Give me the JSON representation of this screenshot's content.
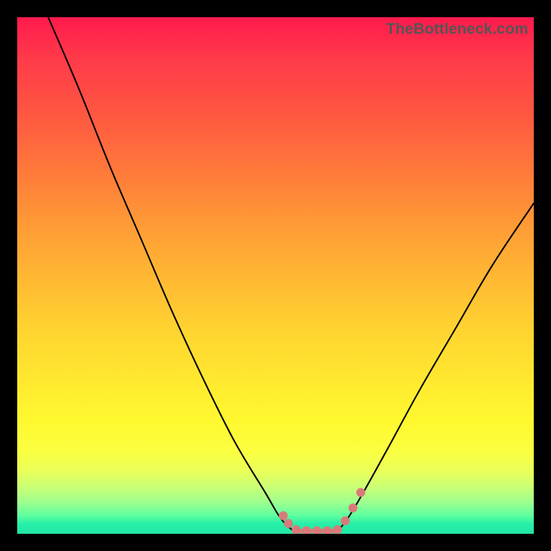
{
  "watermark": "TheBottleneck.com",
  "colors": {
    "frame": "#000000",
    "gradient_top": "#ff1a4d",
    "gradient_bottom": "#20e8a5",
    "curve": "#000000",
    "marker": "#d97a7a"
  },
  "chart_data": {
    "type": "line",
    "title": "",
    "xlabel": "",
    "ylabel": "",
    "xlim": [
      0,
      100
    ],
    "ylim": [
      0,
      100
    ],
    "series": [
      {
        "name": "left-curve",
        "x": [
          6,
          12,
          18,
          24,
          30,
          36,
          42,
          48,
          51,
          53.5
        ],
        "y": [
          100,
          86,
          71,
          57,
          43,
          30,
          18,
          8,
          3,
          0.5
        ]
      },
      {
        "name": "right-curve",
        "x": [
          62,
          64,
          67,
          72,
          78,
          85,
          92,
          100
        ],
        "y": [
          0.5,
          3,
          8,
          17,
          28,
          40,
          52,
          64
        ]
      },
      {
        "name": "flat-bottom",
        "x": [
          53.5,
          62
        ],
        "y": [
          0.5,
          0.5
        ]
      }
    ],
    "markers": {
      "name": "bottom-dots",
      "points": [
        {
          "x": 51.5,
          "y": 3.5
        },
        {
          "x": 52.5,
          "y": 2
        },
        {
          "x": 54,
          "y": 0.8
        },
        {
          "x": 56,
          "y": 0.6
        },
        {
          "x": 58,
          "y": 0.6
        },
        {
          "x": 60,
          "y": 0.6
        },
        {
          "x": 62,
          "y": 0.8
        },
        {
          "x": 63.5,
          "y": 2.5
        },
        {
          "x": 65,
          "y": 5
        },
        {
          "x": 66.5,
          "y": 8
        }
      ]
    }
  }
}
